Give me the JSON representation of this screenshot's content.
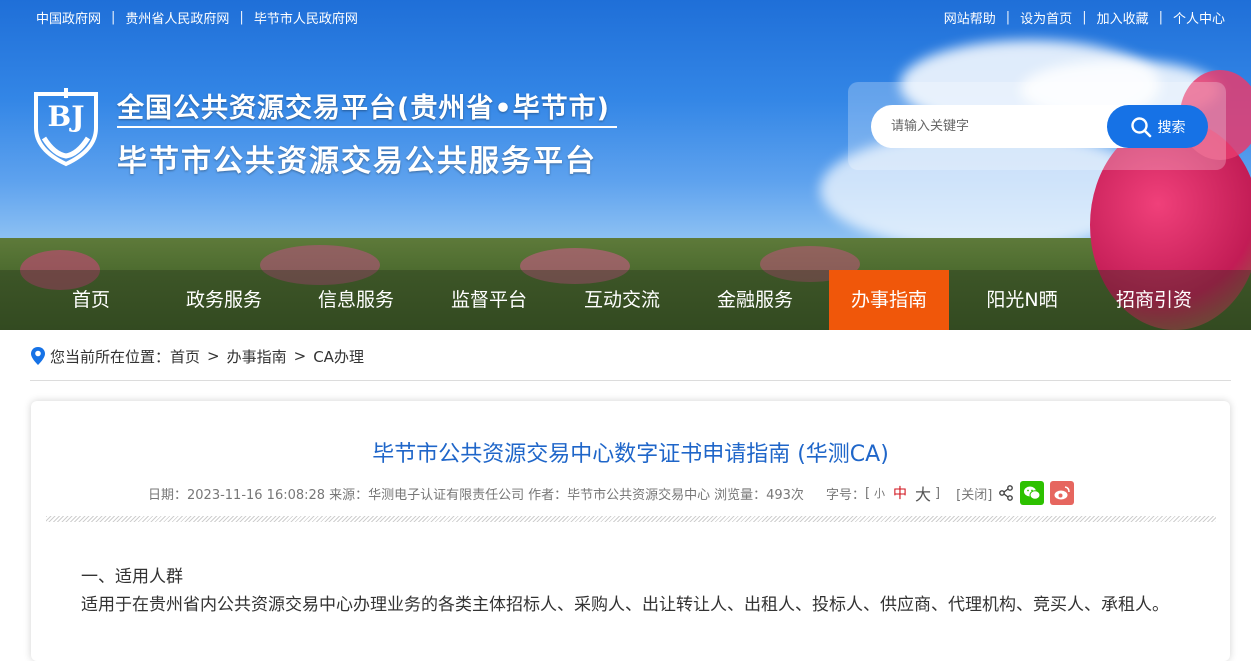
{
  "topbar": {
    "left_links": [
      "中国政府网",
      "贵州省人民政府网",
      "毕节市人民政府网"
    ],
    "right_links": [
      "网站帮助",
      "设为首页",
      "加入收藏",
      "个人中心"
    ],
    "separator": "|"
  },
  "logo": {
    "text": "BJ"
  },
  "header": {
    "title_line1": "全国公共资源交易平台(贵州省•毕节市)",
    "title_line2": "毕节市公共资源交易公共服务平台"
  },
  "search": {
    "placeholder": "请输入关键字",
    "button_label": "搜索"
  },
  "nav": {
    "items": [
      "首页",
      "政务服务",
      "信息服务",
      "监督平台",
      "互动交流",
      "金融服务",
      "办事指南",
      "阳光N晒",
      "招商引资"
    ],
    "active_index": 6
  },
  "breadcrumb": {
    "prefix": "您当前所在位置：",
    "items": [
      "首页",
      "办事指南",
      "CA办理"
    ],
    "separator": ">"
  },
  "article": {
    "title": "毕节市公共资源交易中心数字证书申请指南 (华测CA)",
    "meta": {
      "date": "日期：2023-11-16 16:08:28",
      "source": "来源：华测电子认证有限责任公司",
      "author": "作者：毕节市公共资源交易中心",
      "views": "浏览量：493次",
      "font_size_label": "字号：",
      "bracket_open": "[",
      "size_small": "小",
      "size_medium": "中",
      "size_large": "大",
      "bracket_close": "]",
      "close_label": "[关闭]"
    },
    "paragraphs": [
      "一、适用人群",
      "适用于在贵州省内公共资源交易中心办理业务的各类主体招标人、采购人、出让转让人、出租人、投标人、供应商、代理机构、竞买人、承租人。"
    ]
  },
  "colors": {
    "accent": "#1672e6",
    "nav_active": "#f0570a",
    "title_blue": "#1f66c9",
    "wechat_green": "#2dc100",
    "weibo_red": "#e6665f"
  }
}
